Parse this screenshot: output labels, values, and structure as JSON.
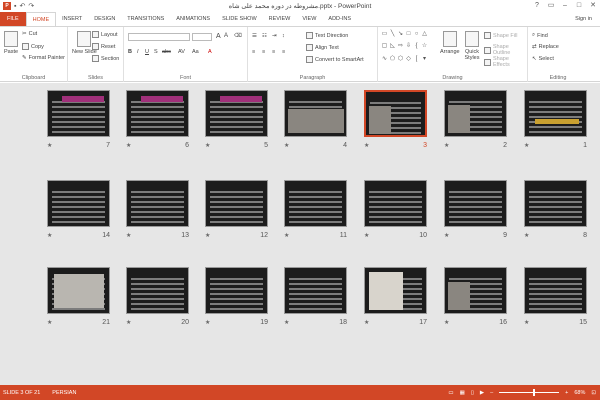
{
  "window": {
    "title": "مشروطه در دوره محمد علی شاه.pptx - PowerPoint",
    "signin": "Sign in"
  },
  "tabs": [
    "FILE",
    "HOME",
    "INSERT",
    "DESIGN",
    "TRANSITIONS",
    "ANIMATIONS",
    "SLIDE SHOW",
    "REVIEW",
    "VIEW",
    "ADD-INS"
  ],
  "ribbon": {
    "clipboard": {
      "label": "Clipboard",
      "paste": "Paste",
      "cut": "Cut",
      "copy": "Copy",
      "format_painter": "Format Painter"
    },
    "slides": {
      "label": "Slides",
      "new_slide": "New Slide",
      "layout": "Layout",
      "reset": "Reset",
      "section": "Section"
    },
    "font": {
      "label": "Font"
    },
    "paragraph": {
      "label": "Paragraph",
      "text_direction": "Text Direction",
      "align_text": "Align Text",
      "convert": "Convert to SmartArt"
    },
    "drawing": {
      "label": "Drawing",
      "arrange": "Arrange",
      "quick_styles": "Quick Styles",
      "shape_fill": "Shape Fill",
      "shape_outline": "Shape Outline",
      "shape_effects": "Shape Effects"
    },
    "editing": {
      "label": "Editing",
      "find": "Find",
      "replace": "Replace",
      "select": "Select"
    }
  },
  "slides": [
    {
      "n": "1"
    },
    {
      "n": "2"
    },
    {
      "n": "3",
      "selected": true
    },
    {
      "n": "4"
    },
    {
      "n": "5"
    },
    {
      "n": "6"
    },
    {
      "n": "7"
    },
    {
      "n": "8"
    },
    {
      "n": "9"
    },
    {
      "n": "10"
    },
    {
      "n": "11"
    },
    {
      "n": "12"
    },
    {
      "n": "13"
    },
    {
      "n": "14"
    },
    {
      "n": "15"
    },
    {
      "n": "16"
    },
    {
      "n": "17"
    },
    {
      "n": "18"
    },
    {
      "n": "19"
    },
    {
      "n": "20"
    },
    {
      "n": "21"
    }
  ],
  "star": "★",
  "status": {
    "slide": "SLIDE 3 OF 21",
    "language": "PERSIAN",
    "zoom": "68%"
  }
}
